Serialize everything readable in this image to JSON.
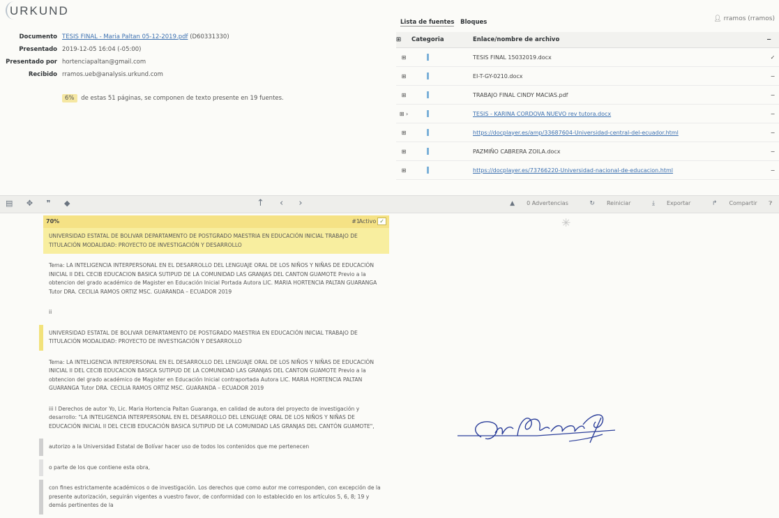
{
  "app": {
    "logo": "URKUND"
  },
  "document_info": {
    "documento_label": "Documento",
    "documento_link": "TESIS FINAL - Maria Paltan 05-12-2019.pdf",
    "documento_id": "(D60331330)",
    "presentado_label": "Presentado",
    "presentado_value": "2019-12-05 16:04 (-05:00)",
    "presentado_por_label": "Presentado por",
    "presentado_por_value": "hortenciapaltan@gmail.com",
    "recibido_label": "Recibido",
    "recibido_value": "rramos.ueb@analysis.urkund.com",
    "summary_pct": "6%",
    "summary_text": "de estas 51 páginas, se componen de texto presente en 19 fuentes."
  },
  "sources": {
    "tab_list": "Lista de fuentes",
    "tab_blocks": "Bloques",
    "user": "rramos (rramos)",
    "header_category": "Categoria",
    "header_name": "Enlace/nombre de archivo",
    "rows": [
      {
        "name": "TESIS FINAL 15032019.docx",
        "link": false,
        "end": "✓"
      },
      {
        "name": "EI-T-GY-0210.docx",
        "link": false,
        "end": "−"
      },
      {
        "name": "TRABAJO FINAL CINDY MACIAS.pdf",
        "link": false,
        "end": "−"
      },
      {
        "name": "TESIS - KARINA CORDOVA NUEVO rev tutora.docx",
        "link": true,
        "end": "−"
      },
      {
        "name": "https://docplayer.es/amp/33687604-Universidad-central-del-ecuador.html",
        "link": true,
        "end": "−"
      },
      {
        "name": "PAZMIÑO CABRERA ZOILA.docx",
        "link": false,
        "end": "−"
      },
      {
        "name": "https://docplayer.es/73766220-Universidad-nacional-de-educacion.html",
        "link": true,
        "end": "−"
      }
    ]
  },
  "toolbar": {
    "advertencias": "0 Advertencias",
    "reiniciar": "Reiniciar",
    "exportar": "Exportar",
    "compartir": "Compartir"
  },
  "match": {
    "pct": "70%",
    "number": "#1",
    "active_label": "Activo"
  },
  "paragraphs": [
    "UNIVERSIDAD ESTATAL DE BOLIVAR DEPARTAMENTO DE POSTGRADO MAESTRIA EN EDUCACIÓN INICIAL TRABAJO DE TITULACIÓN MODALIDAD: PROYECTO DE INVESTIGACIÓN Y DESARROLLO",
    "Tema: LA INTELIGENCIA INTERPERSONAL EN EL DESARROLLO DEL LENGUAJE ORAL DE LOS NIÑOS Y NIÑAS DE EDUCACIÓN INICIAL II DEL CECIB EDUCACION BASICA SUTIPUD DE LA COMUNIDAD LAS GRANJAS DEL CANTON GUAMOTE Previo a la obtencion del grado académico de Magister en Educación Inicial Portada Autora LIC. MARIA HORTENCIA PALTAN GUARANGA Tutor DRA. CECILIA RAMOS ORTIZ MSC. GUARANDA – ECUADOR 2019",
    "ii",
    "UNIVERSIDAD ESTATAL DE BOLIVAR DEPARTAMENTO DE POSTGRADO MAESTRIA EN EDUCACIÓN INICIAL TRABAJO DE TITULACIÓN MODALIDAD: PROYECTO DE INVESTIGACIÓN Y DESARROLLO",
    "Tema: LA INTELIGENCIA INTERPERSONAL EN EL DESARROLLO DEL LENGUAJE ORAL DE LOS NIÑOS Y NIÑAS DE EDUCACIÓN INICIAL II DEL CECIB EDUCACION BASICA SUTIPUD DE LA COMUNIDAD LAS GRANJAS DEL CANTON GUAMOTE Previo a la obtencion del grado académico de Magister en Educación Inicial contraportada Autora LIC. MARIA HORTENCIA PALTAN GUARANGA Tutor DRA. CECILIA RAMOS ORTIZ MSC. GUARANDA – ECUADOR 2019",
    "iii I Derechos de autor Yo, Lic. Maria Hortencia Paltan Guaranga, en calidad de autora del proyecto de investigación y desarrollo: \"LA INTELIGENCIA INTERPERSONAL EN EL DESARROLLO DEL LENGUAJE ORAL DE LOS NIÑOS Y NIÑAS DE EDUCACIÓN INICIAL II DEL CECIB EDUCACIÓN BASICA SUTIPUD DE LA COMUNIDAD LAS GRANJAS DEL CANTÓN GUAMOTE\",",
    "autorizo a la Universidad Estatal de Bolívar hacer uso de todos los contenidos que me pertenecen",
    "o parte de los que contiene esta obra,",
    "con fines estrictamente académicos o de investigación. Los derechos que como autor me corresponden, con excepción de la presente autorización, seguirán vigentes a vuestro favor, de conformidad con lo establecido en los artículos 5, 6, 8; 19 y demás pertinentes de la"
  ]
}
